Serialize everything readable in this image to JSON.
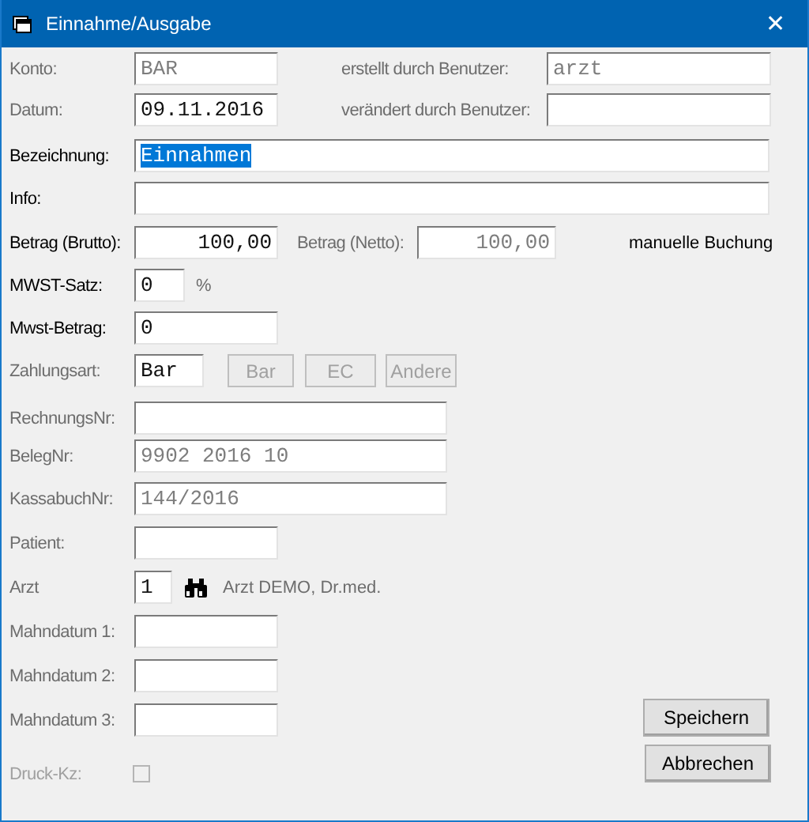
{
  "window": {
    "title": "Einnahme/Ausgabe",
    "close": "✕"
  },
  "account": {
    "label": "Konto:",
    "label_disabled": true,
    "value": "BAR",
    "disabled": true
  },
  "created_by": {
    "label": "erstellt durch Benutzer:",
    "label_disabled": true,
    "value": "arzt",
    "disabled": true
  },
  "date": {
    "label": "Datum:",
    "label_disabled": true,
    "value": "09.11.2016"
  },
  "modified_by": {
    "label": "verändert durch Benutzer:",
    "label_disabled": true
  },
  "description": {
    "label": "Bezeichnung:",
    "label_disabled": false,
    "value": "Einnahmen",
    "selected": true
  },
  "info": {
    "label": "Info:",
    "label_disabled": false
  },
  "gross": {
    "label": "Betrag (Brutto):",
    "label_disabled": false,
    "value": "100,00"
  },
  "net": {
    "label": "Betrag (Netto):",
    "label_disabled": true,
    "value": "100,00",
    "disabled": true
  },
  "manual_booking": "manuelle Buchung",
  "vat_rate": {
    "label": "MWST-Satz:",
    "label_disabled": false,
    "value": "0",
    "unit": "%"
  },
  "vat_amount": {
    "label": "Mwst-Betrag:",
    "label_disabled": false,
    "value": "0"
  },
  "payment_type": {
    "label": "Zahlungsart:",
    "label_disabled": true,
    "value": "Bar",
    "buttons": [
      {
        "label": "Bar",
        "disabled": true
      },
      {
        "label": "EC",
        "disabled": true
      },
      {
        "label": "Andere",
        "disabled": true
      }
    ]
  },
  "invoice_no": {
    "label": "RechnungsNr:",
    "label_disabled": true
  },
  "receipt_no": {
    "label": "BelegNr:",
    "label_disabled": true,
    "value": "9902 2016 10",
    "disabled": true
  },
  "cashbook_no": {
    "label": "KassabuchNr:",
    "label_disabled": true,
    "value": "144/2016",
    "disabled": true
  },
  "patient": {
    "label": "Patient:",
    "label_disabled": true
  },
  "doctor": {
    "label": "Arzt",
    "label_disabled": true,
    "value": "1",
    "name": "Arzt DEMO, Dr.med."
  },
  "dunning_dates": [
    {
      "label": "Mahndatum 1:",
      "label_disabled": true
    },
    {
      "label": "Mahndatum 2:",
      "label_disabled": true
    },
    {
      "label": "Mahndatum 3:",
      "label_disabled": true
    }
  ],
  "print_flag": {
    "label": "Druck-Kz:",
    "checked": false,
    "disabled": true
  },
  "buttons": [
    {
      "label": "Speichern"
    },
    {
      "label": "Abbrechen"
    }
  ]
}
